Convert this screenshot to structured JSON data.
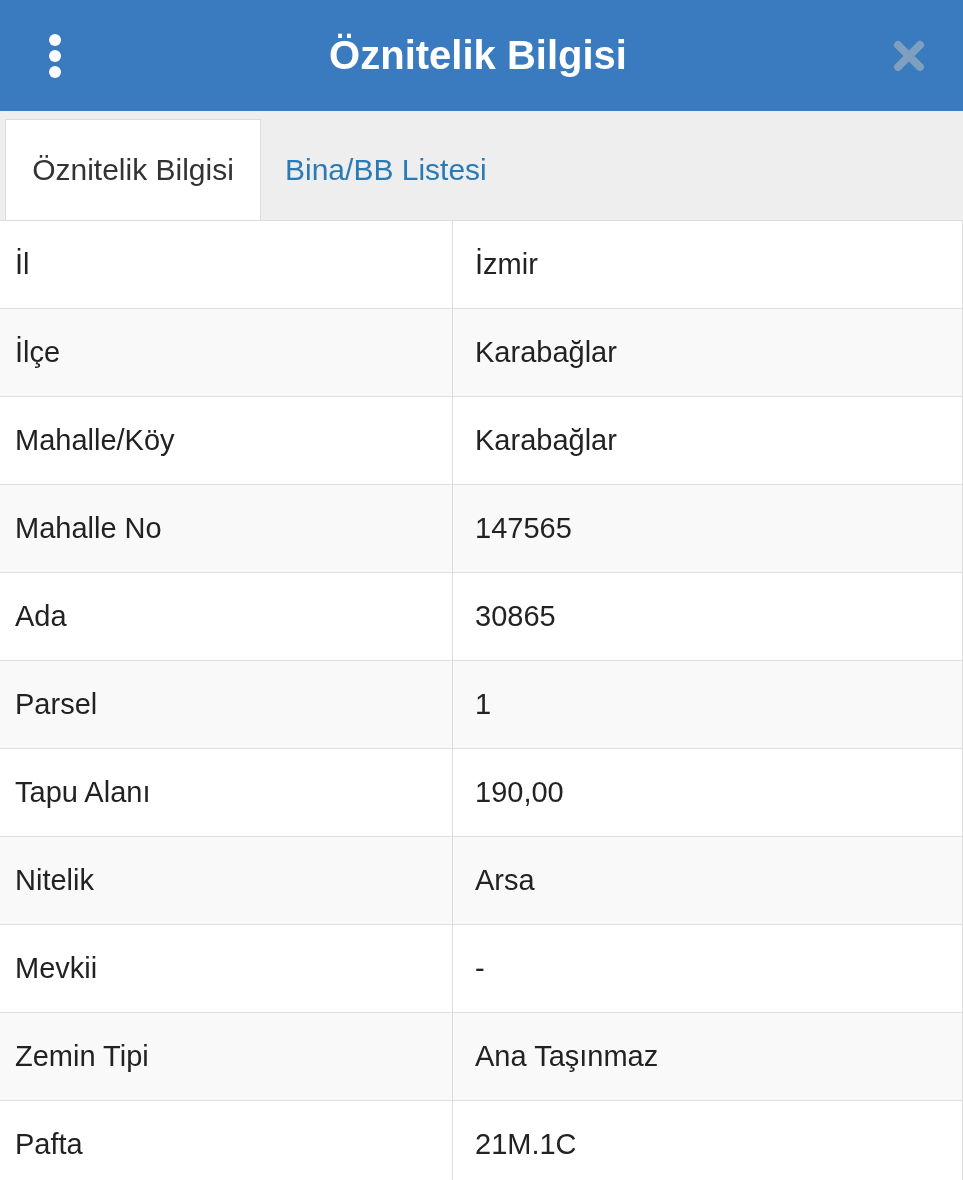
{
  "header": {
    "title": "Öznitelik Bilgisi"
  },
  "tabs": [
    {
      "label": "Öznitelik Bilgisi",
      "selected": true
    },
    {
      "label": "Bina/BB Listesi",
      "selected": false
    }
  ],
  "rows": [
    {
      "label": "İl",
      "value": "İzmir"
    },
    {
      "label": "İlçe",
      "value": "Karabağlar"
    },
    {
      "label": "Mahalle/Köy",
      "value": "Karabağlar"
    },
    {
      "label": "Mahalle No",
      "value": "147565"
    },
    {
      "label": "Ada",
      "value": "30865"
    },
    {
      "label": "Parsel",
      "value": "1"
    },
    {
      "label": "Tapu Alanı",
      "value": "190,00"
    },
    {
      "label": "Nitelik",
      "value": "Arsa"
    },
    {
      "label": "Mevkii",
      "value": "-"
    },
    {
      "label": "Zemin Tipi",
      "value": "Ana Taşınmaz"
    },
    {
      "label": "Pafta",
      "value": "21M.1C"
    }
  ]
}
